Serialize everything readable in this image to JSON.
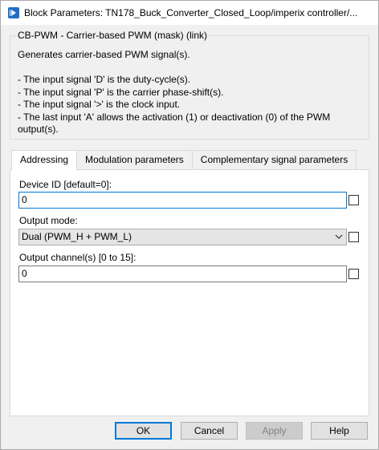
{
  "window": {
    "title": "Block Parameters: TN178_Buck_Converter_Closed_Loop/imperix controller/..."
  },
  "block": {
    "group_title": "CB-PWM - Carrier-based PWM (mask) (link)",
    "description": "Generates carrier-based PWM signal(s).",
    "notes": [
      "- The input signal 'D' is the duty-cycle(s).",
      "- The input signal 'P' is the carrier phase-shift(s).",
      "- The input signal '>' is the clock input.",
      "- The last input 'A' allows the activation (1) or deactivation (0) of the PWM",
      "output(s)."
    ]
  },
  "tabs": [
    {
      "label": "Addressing",
      "active": true
    },
    {
      "label": "Modulation parameters",
      "active": false
    },
    {
      "label": "Complementary signal parameters",
      "active": false
    }
  ],
  "fields": {
    "device_id": {
      "label": "Device ID [default=0]:",
      "value": "0"
    },
    "output_mode": {
      "label": "Output mode:",
      "value": "Dual (PWM_H + PWM_L)"
    },
    "output_channel": {
      "label": "Output channel(s) [0 to 15]:",
      "value": "0"
    }
  },
  "buttons": {
    "ok": "OK",
    "cancel": "Cancel",
    "apply": "Apply",
    "help": "Help"
  }
}
